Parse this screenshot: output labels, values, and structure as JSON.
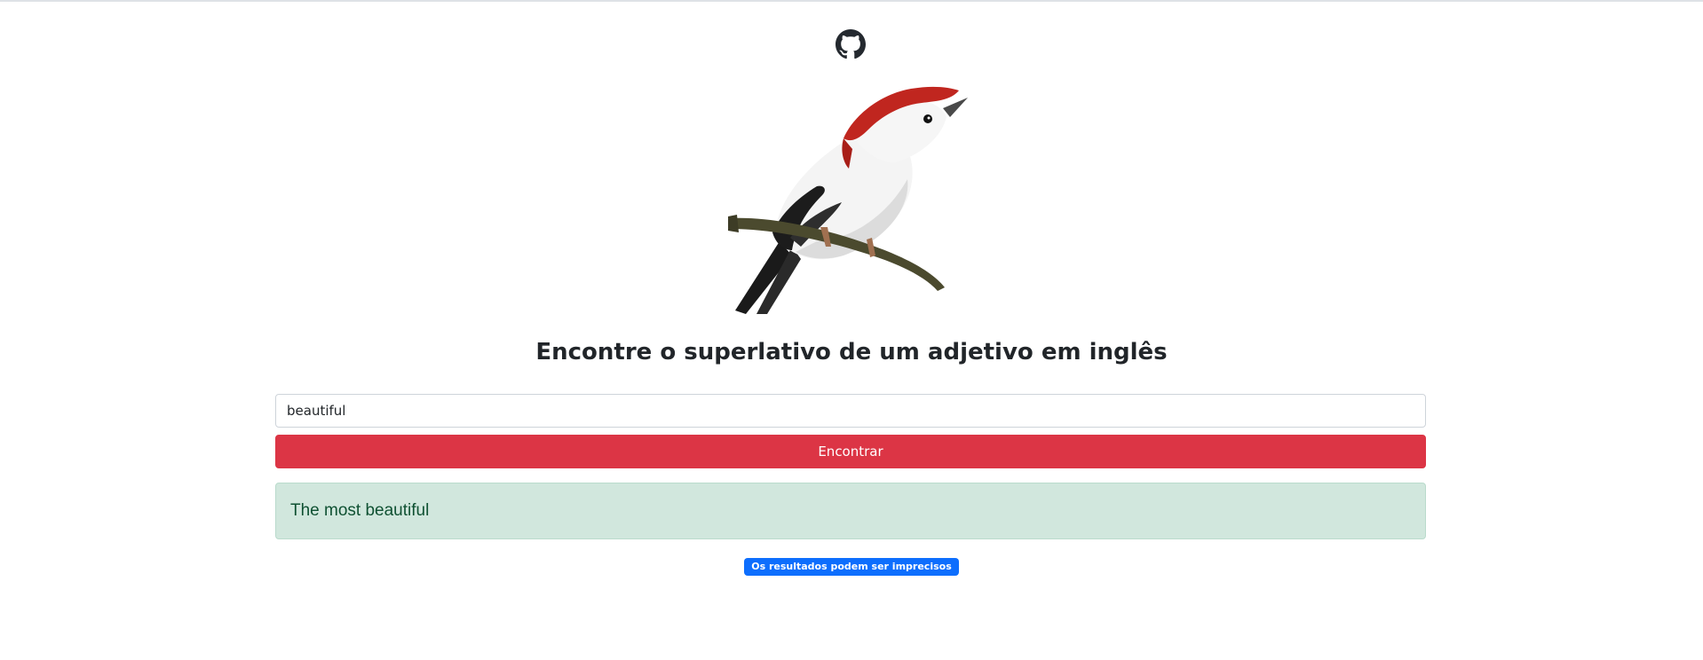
{
  "header": {
    "github_icon": "github-icon"
  },
  "hero": {
    "image": "bird-illustration",
    "title": "Encontre o superlativo de um adjetivo em inglês"
  },
  "form": {
    "input_value": "beautiful",
    "button_label": "Encontrar"
  },
  "result": {
    "text": "The most beautiful"
  },
  "disclaimer": {
    "text": "Os resultados podem ser imprecisos"
  },
  "colors": {
    "button": "#dc3545",
    "result_bg": "#d1e7dd",
    "result_text": "#0f5132",
    "badge": "#0d6efd"
  }
}
